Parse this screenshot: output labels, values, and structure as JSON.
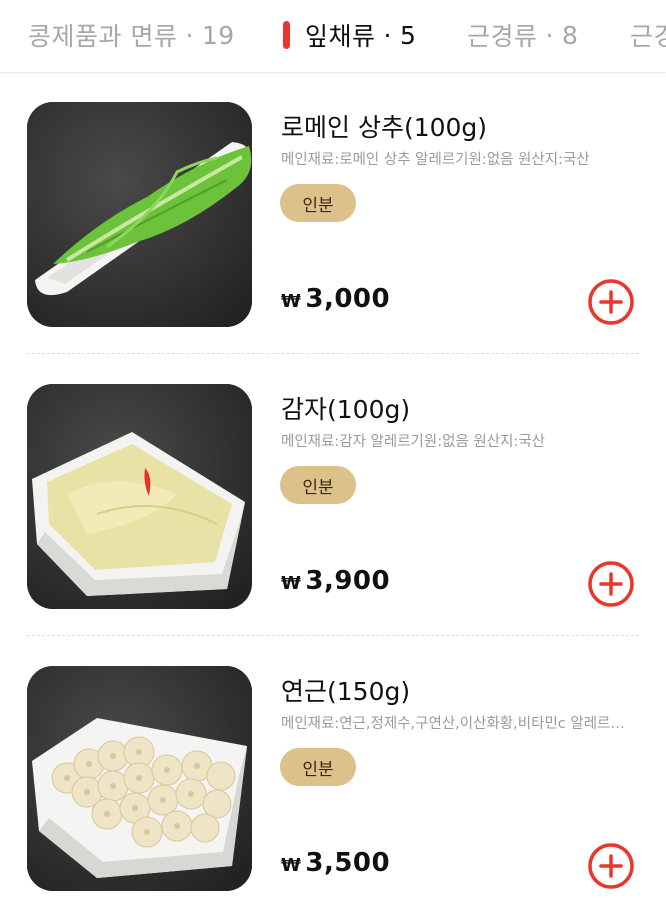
{
  "tabs": [
    {
      "label": "콩제품과 면류",
      "count": "19",
      "active": false
    },
    {
      "label": "잎채류",
      "count": "5",
      "active": true
    },
    {
      "label": "근경류",
      "count": "8",
      "active": false
    },
    {
      "label": "근경",
      "count": "",
      "active": false
    }
  ],
  "tab_separator": "·",
  "currency_symbol": "₩",
  "accent_color": "#e8372c",
  "badge_color": "#dcc18a",
  "items": [
    {
      "name": "로메인 상추(100g)",
      "description": "메인재료:로메인 상추 알레르기원:없음 원산지:국산",
      "badge": "인분",
      "price": "3,000",
      "image": "romaine-lettuce"
    },
    {
      "name": "감자(100g)",
      "description": "메인재료:감자 알레르기원:없음 원산지:국산",
      "badge": "인분",
      "price": "3,900",
      "image": "sliced-potato"
    },
    {
      "name": "연근(150g)",
      "description": "메인재료:연근,정제수,구연산,이산화황,비타민c 알레르기원:없음 원산지:국산",
      "badge": "인분",
      "price": "3,500",
      "image": "lotus-root"
    }
  ]
}
